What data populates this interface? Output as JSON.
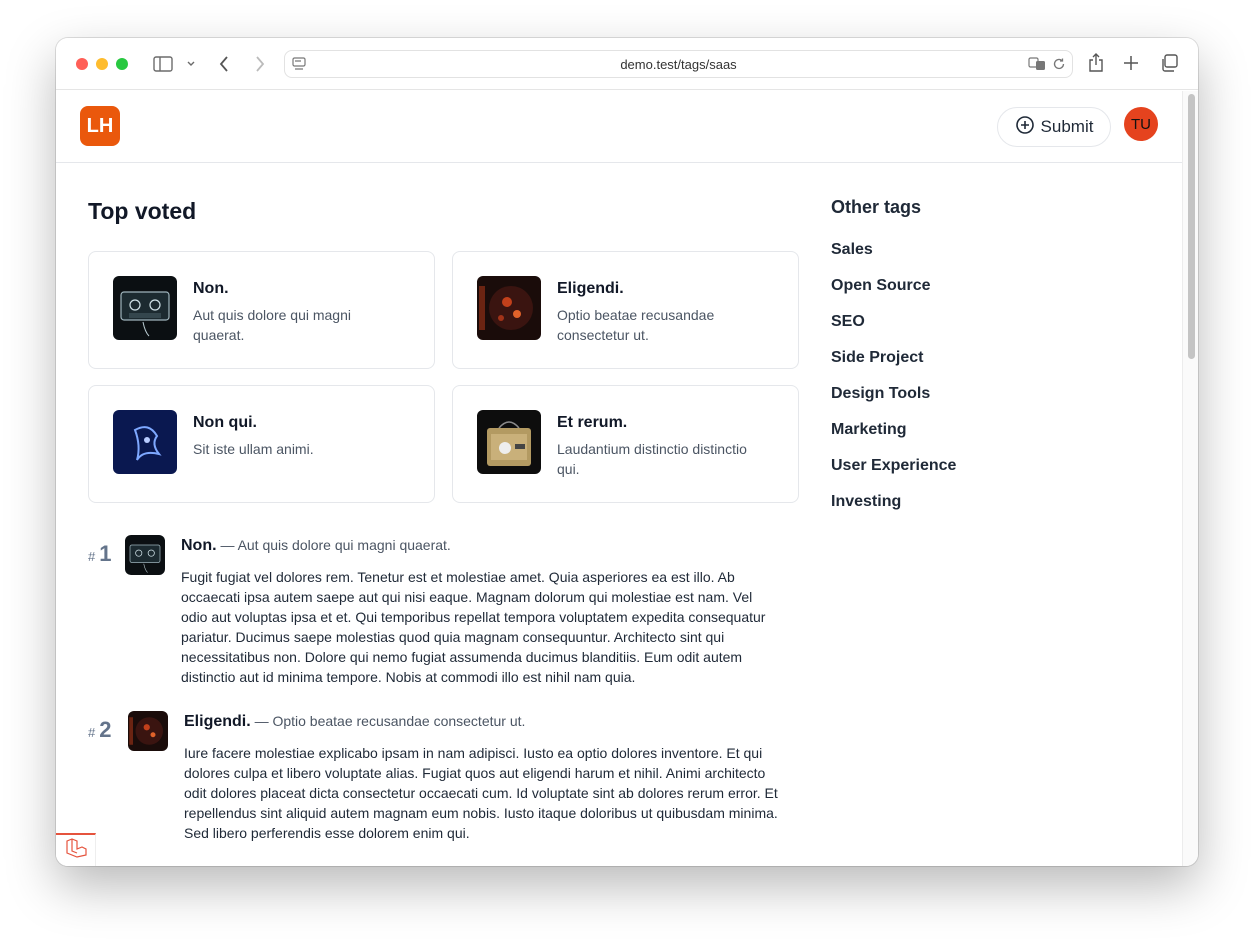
{
  "browser": {
    "url": "demo.test/tags/saas"
  },
  "header": {
    "logo_text": "LH",
    "submit_label": "Submit",
    "avatar_initials": "TU"
  },
  "main": {
    "heading": "Top voted",
    "cards": [
      {
        "title": "Non.",
        "desc": "Aut quis dolore qui magni quaerat."
      },
      {
        "title": "Eligendi.",
        "desc": "Optio beatae recusandae consectetur ut."
      },
      {
        "title": "Non qui.",
        "desc": "Sit iste ullam animi."
      },
      {
        "title": "Et rerum.",
        "desc": "Laudantium distinctio distinctio qui."
      }
    ],
    "ranked": [
      {
        "hash": "#",
        "rank": "1",
        "title": "Non.",
        "dash": "—",
        "tagline": "Aut quis dolore qui magni quaerat.",
        "body": "Fugit fugiat vel dolores rem. Tenetur est et molestiae amet. Quia asperiores ea est illo. Ab occaecati ipsa autem saepe aut qui nisi eaque. Magnam dolorum qui molestiae est nam. Vel odio aut voluptas ipsa et et. Qui temporibus repellat tempora voluptatem expedita consequatur pariatur. Ducimus saepe molestias quod quia magnam consequuntur. Architecto sint qui necessitatibus non. Dolore qui nemo fugiat assumenda ducimus blanditiis. Eum odit autem distinctio aut id minima tempore. Nobis at commodi illo est nihil nam quia."
      },
      {
        "hash": "#",
        "rank": "2",
        "title": "Eligendi.",
        "dash": "—",
        "tagline": "Optio beatae recusandae consectetur ut.",
        "body": "Iure facere molestiae explicabo ipsam in nam adipisci. Iusto ea optio dolores inventore. Et qui dolores culpa et libero voluptate alias. Fugiat quos aut eligendi harum et nihil. Animi architecto odit dolores placeat dicta consectetur occaecati cum. Id voluptate sint ab dolores rerum error. Et repellendus sint aliquid autem magnam eum nobis. Iusto itaque doloribus ut quibusdam minima. Sed libero perferendis esse dolorem enim qui."
      }
    ]
  },
  "aside": {
    "title": "Other tags",
    "tags": [
      "Sales",
      "Open Source",
      "SEO",
      "Side Project",
      "Design Tools",
      "Marketing",
      "User Experience",
      "Investing"
    ]
  },
  "colors": {
    "brand": "#ea580c",
    "avatar": "#e5431e"
  }
}
